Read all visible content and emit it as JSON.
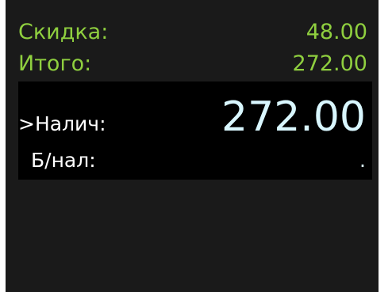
{
  "summary": {
    "discount_label": "Скидка:",
    "discount_value": "48.00",
    "total_label": "Итого:",
    "total_value": "272.00"
  },
  "payment": {
    "cash_label": ">Налич:",
    "cash_value": "272.00",
    "card_label": "Б/нал:",
    "card_value": "."
  },
  "colors": {
    "summary_text": "#8fcf3f",
    "panel_bg": "#1a1a1a",
    "payment_bg": "#000000",
    "payment_text": "#ffffff",
    "amount_text": "#d9f7ff"
  }
}
